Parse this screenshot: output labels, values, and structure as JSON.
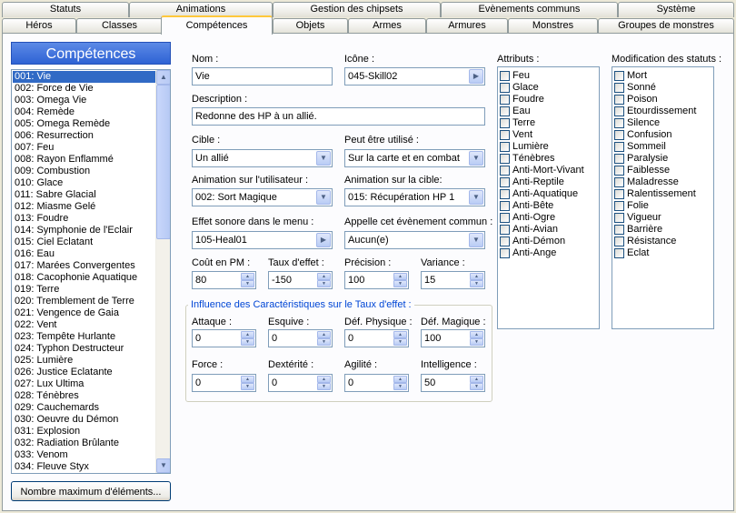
{
  "tabs_row1": [
    "Statuts",
    "Animations",
    "Gestion des chipsets",
    "Evènements communs",
    "Système"
  ],
  "tabs_row2": [
    "Héros",
    "Classes",
    "Compétences",
    "Objets",
    "Armes",
    "Armures",
    "Monstres",
    "Groupes de monstres"
  ],
  "active_tab": "Compétences",
  "sidebar": {
    "title": "Compétences",
    "items": [
      "001: Vie",
      "002: Force de Vie",
      "003: Omega Vie",
      "004: Remède",
      "005: Omega Remède",
      "006: Resurrection",
      "007: Feu",
      "008: Rayon Enflammé",
      "009: Combustion",
      "010: Glace",
      "011: Sabre Glacial",
      "012: Miasme Gelé",
      "013: Foudre",
      "014: Symphonie de l'Eclair",
      "015: Ciel Eclatant",
      "016: Eau",
      "017: Marées Convergentes",
      "018: Cacophonie Aquatique",
      "019: Terre",
      "020: Tremblement de Terre",
      "021: Vengence de Gaia",
      "022: Vent",
      "023: Tempête Hurlante",
      "024: Typhon Destructeur",
      "025: Lumière",
      "026: Justice Eclatante",
      "027: Lux Ultima",
      "028: Ténèbres",
      "029: Cauchemards",
      "030: Oeuvre du Démon",
      "031: Explosion",
      "032: Radiation Brûlante",
      "033: Venom",
      "034: Fleuve Styx"
    ],
    "selected_index": 0,
    "max_button": "Nombre maximum d'éléments..."
  },
  "form": {
    "name_label": "Nom :",
    "name_value": "Vie",
    "icon_label": "Icône :",
    "icon_value": "045-Skill02",
    "desc_label": "Description :",
    "desc_value": "Redonne des HP à un allié.",
    "target_label": "Cible :",
    "target_value": "Un allié",
    "usable_label": "Peut être utilisé :",
    "usable_value": "Sur la carte et en combat",
    "anim_user_label": "Animation sur l'utilisateur :",
    "anim_user_value": "002: Sort Magique",
    "anim_target_label": "Animation sur la cible:",
    "anim_target_value": "015: Récupération HP 1",
    "menu_se_label": "Effet sonore dans le menu :",
    "menu_se_value": "105-Heal01",
    "common_event_label": "Appelle cet évènement commun :",
    "common_event_value": "Aucun(e)",
    "sp_cost_label": "Coût en PM :",
    "sp_cost_value": "80",
    "power_label": "Taux d'effet :",
    "power_value": "-150",
    "hit_label": "Précision :",
    "hit_value": "100",
    "variance_label": "Variance :",
    "variance_value": "15"
  },
  "influence": {
    "title": "Influence des Caractéristiques sur le Taux d'effet :",
    "atk_label": "Attaque :",
    "atk_value": "0",
    "eva_label": "Esquive :",
    "eva_value": "0",
    "pdef_label": "Déf. Physique :",
    "pdef_value": "0",
    "mdef_label": "Déf. Magique :",
    "mdef_value": "100",
    "str_label": "Force :",
    "str_value": "0",
    "dex_label": "Dextérité :",
    "dex_value": "0",
    "agi_label": "Agilité :",
    "agi_value": "0",
    "int_label": "Intelligence :",
    "int_value": "50"
  },
  "attributes": {
    "title": "Attributs :",
    "items": [
      "Feu",
      "Glace",
      "Foudre",
      "Eau",
      "Terre",
      "Vent",
      "Lumière",
      "Ténèbres",
      "Anti-Mort-Vivant",
      "Anti-Reptile",
      "Anti-Aquatique",
      "Anti-Bête",
      "Anti-Ogre",
      "Anti-Avian",
      "Anti-Démon",
      "Anti-Ange"
    ]
  },
  "states": {
    "title": "Modification des statuts :",
    "items": [
      "Mort",
      "Sonné",
      "Poison",
      "Etourdissement",
      "Silence",
      "Confusion",
      "Sommeil",
      "Paralysie",
      "Faiblesse",
      "Maladresse",
      "Ralentissement",
      "Folie",
      "Vigueur",
      "Barrière",
      "Résistance",
      "Eclat"
    ]
  }
}
